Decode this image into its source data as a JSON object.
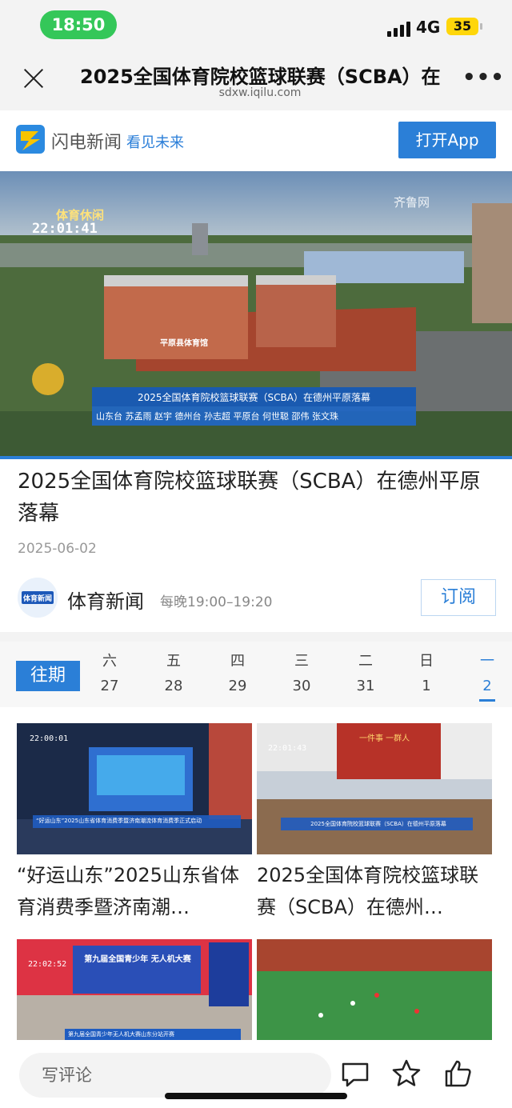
{
  "status": {
    "time": "18:50",
    "network": "4G",
    "battery": "35"
  },
  "titlebar": {
    "title": "2025全国体育院校篮球联赛（SCBA）在",
    "url": "sdxw.iqilu.com"
  },
  "app_banner": {
    "brand": "闪电新闻",
    "slogan": "看见未来",
    "open_label": "打开App"
  },
  "video": {
    "logo_text": "体育休闲",
    "clock": "22:01:41",
    "watermark": "齐鲁网",
    "caption_main": "2025全国体育院校篮球联赛（SCBA）在德州平原落幕",
    "caption_sub": "山东台 苏孟雨 赵宇 德州台 孙志超  平原台 何世聪 邵伟 张文珠",
    "building_sign": "平原县体育馆",
    "progress": 1.0
  },
  "article": {
    "title": "2025全国体育院校篮球联赛（SCBA）在德州平原落幕",
    "date": "2025-06-02"
  },
  "channel": {
    "name": "体育新闻",
    "schedule": "每晚19:00–19:20",
    "subscribe_label": "订阅",
    "logo_text": "体育新闻"
  },
  "datestrip": {
    "past_label": "往期",
    "days": [
      {
        "weekday": "六",
        "date": "27"
      },
      {
        "weekday": "五",
        "date": "28"
      },
      {
        "weekday": "四",
        "date": "29"
      },
      {
        "weekday": "三",
        "date": "30"
      },
      {
        "weekday": "二",
        "date": "31"
      },
      {
        "weekday": "日",
        "date": "1"
      },
      {
        "weekday": "一",
        "date": "2"
      }
    ]
  },
  "cards": [
    {
      "title": "“好运山东”2025山东省体育消费季暨济南潮…",
      "clock": "22:00:01",
      "caption": "“好运山东”2025山东省体育消费季暨济南潮流体育消费季正式启动"
    },
    {
      "title": "2025全国体育院校篮球联赛（SCBA）在德州…",
      "clock": "22:01:43",
      "caption": "2025全国体育院校篮球联赛（SCBA）在德州平原落幕",
      "banner": "一件事 一群人"
    },
    {
      "title": "",
      "clock": "22:02:52",
      "caption": "第九届全国青少年无人机大赛山东分站开赛",
      "banner": "第九届全国青少年 无人机大赛"
    },
    {
      "title": "",
      "clock": "",
      "caption": ""
    }
  ],
  "bottombar": {
    "comment_placeholder": "写评论"
  },
  "colors": {
    "accent": "#2b7fd7",
    "status_green": "#34c759",
    "battery_yellow": "#ffd60a"
  }
}
